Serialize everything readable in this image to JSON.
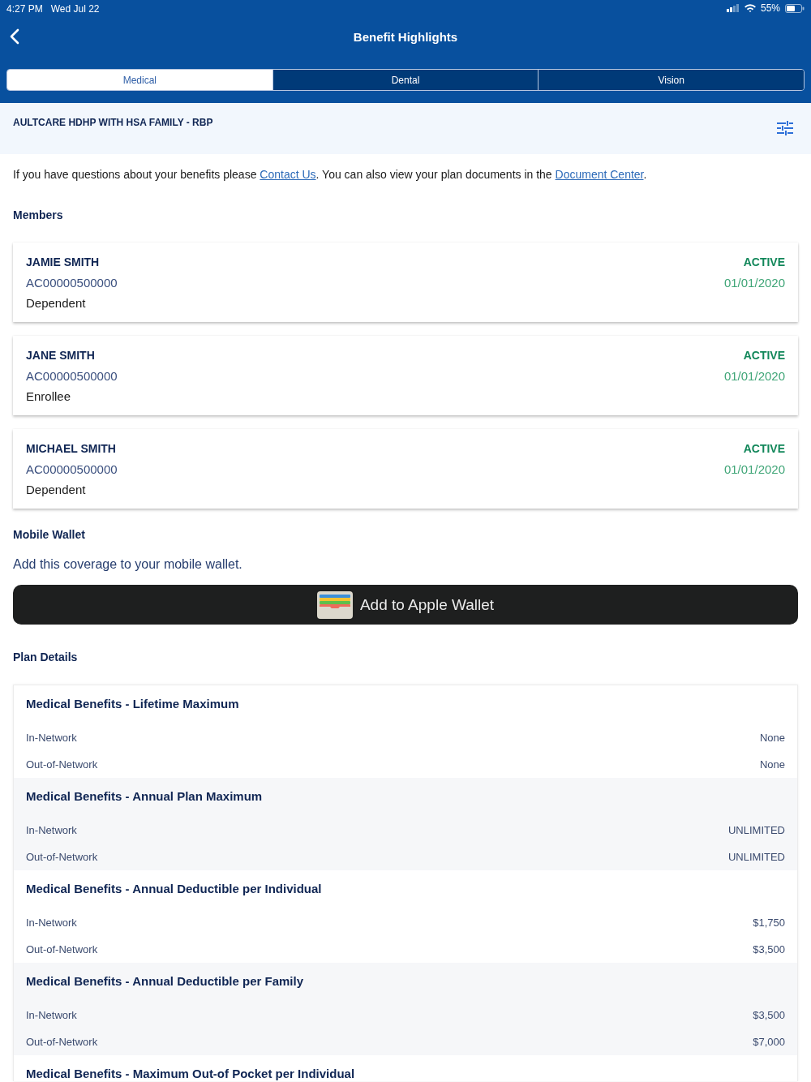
{
  "status_bar": {
    "time": "4:27 PM",
    "date": "Wed Jul 22",
    "battery": "55%"
  },
  "header": {
    "title": "Benefit Highlights"
  },
  "tabs": [
    {
      "label": "Medical",
      "selected": true
    },
    {
      "label": "Dental",
      "selected": false
    },
    {
      "label": "Vision",
      "selected": false
    }
  ],
  "plan": {
    "name": "AULTCARE HDHP WITH HSA FAMILY - RBP"
  },
  "intro": [
    {
      "kind": "text",
      "text": "If you have questions about your benefits please "
    },
    {
      "kind": "link",
      "text": "Contact Us"
    },
    {
      "kind": "text",
      "text": ". You can also view your plan documents in the "
    },
    {
      "kind": "link",
      "text": "Document Center"
    },
    {
      "kind": "text",
      "text": "."
    }
  ],
  "members": {
    "heading": "Members",
    "items": [
      {
        "name": "JAMIE SMITH",
        "id": "AC00000500000",
        "role": "Dependent",
        "status": "ACTIVE",
        "date": "01/01/2020"
      },
      {
        "name": "JANE SMITH",
        "id": "AC00000500000",
        "role": "Enrollee",
        "status": "ACTIVE",
        "date": "01/01/2020"
      },
      {
        "name": "MICHAEL SMITH",
        "id": "AC00000500000",
        "role": "Dependent",
        "status": "ACTIVE",
        "date": "01/01/2020"
      }
    ]
  },
  "mobile_wallet": {
    "heading": "Mobile Wallet",
    "description": "Add this coverage to your mobile wallet.",
    "button": "Add to Apple Wallet"
  },
  "plan_details": {
    "heading": "Plan Details",
    "benefits": [
      {
        "title": "Medical Benefits - Lifetime Maximum",
        "rows": [
          {
            "label": "In-Network",
            "value": "None"
          },
          {
            "label": "Out-of-Network",
            "value": "None"
          }
        ]
      },
      {
        "title": "Medical Benefits - Annual Plan Maximum",
        "rows": [
          {
            "label": "In-Network",
            "value": "UNLIMITED"
          },
          {
            "label": "Out-of-Network",
            "value": "UNLIMITED"
          }
        ]
      },
      {
        "title": "Medical Benefits - Annual Deductible per Individual",
        "rows": [
          {
            "label": "In-Network",
            "value": "$1,750"
          },
          {
            "label": "Out-of-Network",
            "value": "$3,500"
          }
        ]
      },
      {
        "title": "Medical Benefits - Annual Deductible per Family",
        "rows": [
          {
            "label": "In-Network",
            "value": "$3,500"
          },
          {
            "label": "Out-of-Network",
            "value": "$7,000"
          }
        ]
      },
      {
        "title": "Medical Benefits - Maximum Out-of Pocket per Individual"
      }
    ]
  }
}
